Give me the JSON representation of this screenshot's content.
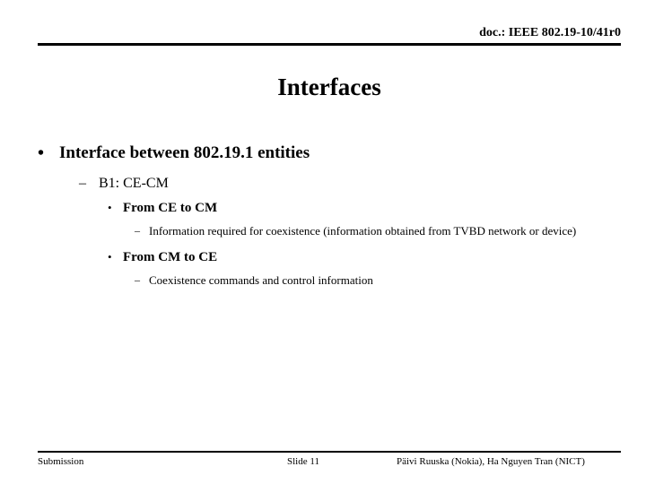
{
  "header": {
    "doc_label": "doc.: IEEE 802.19-10/41r0"
  },
  "title": "Interfaces",
  "outline": {
    "l1_interface": "Interface between 802.19.1 entities",
    "l1_marker": "•",
    "l2_b1": "B1: CE-CM",
    "l2_marker": "–",
    "l3_from_ce_to_cm": "From CE to CM",
    "l3_from_cm_to_ce": "From CM to CE",
    "l3_marker": "•",
    "l4_info_required": "Information required for coexistence (information obtained from TVBD network or device)",
    "l4_coexistence_commands": "Coexistence commands and control information",
    "l4_marker": "–"
  },
  "footer": {
    "submission": "Submission",
    "slide_number": "Slide 11",
    "authors": "Päivi Ruuska (Nokia), Ha Nguyen Tran (NICT)"
  },
  "colors": {
    "text": "#000000",
    "background": "#ffffff",
    "rule": "#000000"
  }
}
